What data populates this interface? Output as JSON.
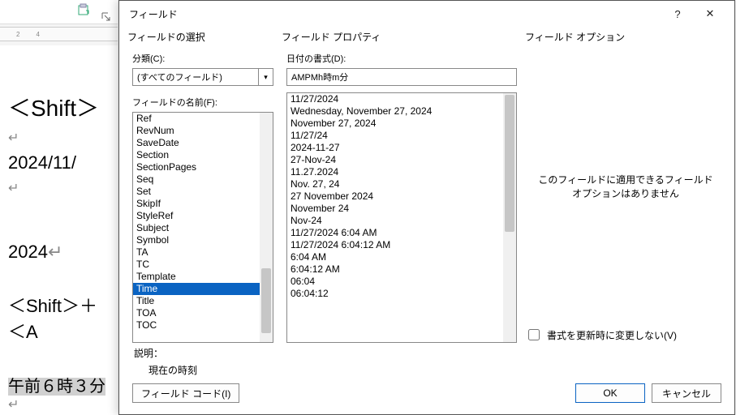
{
  "bg": {
    "shift1": "＜Shift＞",
    "date1": "2024/11/",
    "year": "2024",
    "shift2": "＜Shift＞＋＜A",
    "timejp": "午前６時３分"
  },
  "dialog": {
    "title": "フィールド",
    "help": "?",
    "close": "✕"
  },
  "left": {
    "header": "フィールドの選択",
    "category_label": "分類(C):",
    "category_value": "(すべてのフィールド)",
    "name_label": "フィールドの名前(F):",
    "items": [
      "Ref",
      "RevNum",
      "SaveDate",
      "Section",
      "SectionPages",
      "Seq",
      "Set",
      "SkipIf",
      "StyleRef",
      "Subject",
      "Symbol",
      "TA",
      "TC",
      "Template",
      "Time",
      "Title",
      "TOA",
      "TOC"
    ],
    "selected_index": 14
  },
  "mid": {
    "header": "フィールド プロパティ",
    "format_label": "日付の書式(D):",
    "format_value": "AMPMh時m分",
    "items": [
      "11/27/2024",
      "Wednesday, November 27, 2024",
      "November 27, 2024",
      "11/27/24",
      "2024-11-27",
      "27-Nov-24",
      "11.27.2024",
      "Nov. 27, 24",
      "27 November 2024",
      "November 24",
      "Nov-24",
      "11/27/2024 6:04 AM",
      "11/27/2024 6:04:12 AM",
      "6:04 AM",
      "6:04:12 AM",
      "06:04",
      "06:04:12"
    ]
  },
  "right": {
    "header": "フィールド オプション",
    "empty": "このフィールドに適用できるフィールド オプションはありません",
    "preserve_label": "書式を更新時に変更しない(V)"
  },
  "desc": {
    "label": "説明：",
    "text": "現在の時刻"
  },
  "buttons": {
    "field_codes": "フィールド コード(I)",
    "ok": "OK",
    "cancel": "キャンセル"
  }
}
